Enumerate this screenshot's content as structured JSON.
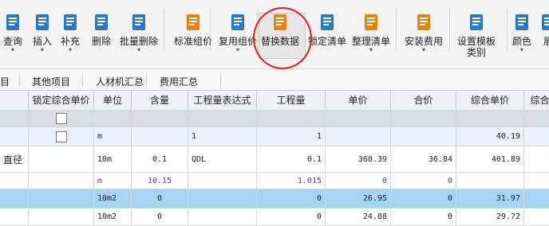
{
  "toolbar": {
    "buttons": [
      {
        "label": "查询",
        "has_arrow": true,
        "icon": "query-icon",
        "color": "#2b78c8"
      },
      {
        "label": "插入",
        "has_arrow": true,
        "icon": "insert-icon",
        "color": "#2b78c8"
      },
      {
        "label": "补充",
        "has_arrow": true,
        "icon": "supplement-icon",
        "color": "#2b78c8"
      },
      {
        "label": "删除",
        "has_arrow": false,
        "icon": "delete-icon",
        "color": "#2b78c8"
      },
      {
        "label": "批量删除",
        "has_arrow": true,
        "icon": "batch-delete-icon",
        "color": "#2b78c8"
      },
      {
        "label": "标准组价",
        "has_arrow": false,
        "icon": "standard-pricing-icon",
        "color": "#e8820e"
      },
      {
        "label": "复用组价",
        "has_arrow": true,
        "icon": "reuse-pricing-icon",
        "color": "#2b78c8"
      },
      {
        "label": "替换数据",
        "has_arrow": false,
        "icon": "replace-data-icon",
        "color": "#e8820e"
      },
      {
        "label": "锁定清单",
        "has_arrow": false,
        "icon": "lock-list-icon",
        "color": "#2b78c8"
      },
      {
        "label": "整理清单",
        "has_arrow": true,
        "icon": "organize-list-icon",
        "color": "#e8820e"
      },
      {
        "label": "安装费用",
        "has_arrow": true,
        "icon": "install-cost-icon",
        "color": "#e8820e"
      },
      {
        "label": "设置模板",
        "label2": "类别",
        "has_arrow": false,
        "icon": "template-category-icon",
        "color": "#2b78c8"
      },
      {
        "label": "颜色",
        "has_arrow": true,
        "icon": "color-icon",
        "color": "#2b78c8"
      },
      {
        "label": "展",
        "has_arrow": false,
        "icon": "expand-icon",
        "color": "#2b78c8"
      }
    ],
    "highlight_color": "#e41d1d"
  },
  "tabs": [
    "目",
    "其他项目",
    "人材机汇总",
    "费用汇总"
  ],
  "table": {
    "headers": [
      "",
      "锁定综合单价",
      "单位",
      "含量",
      "工程量表达式",
      "工程量",
      "单价",
      "合价",
      "综合单价",
      "综合"
    ],
    "rows": [
      {
        "c0": "",
        "lock": false,
        "unit": "",
        "content": "",
        "expr": "",
        "qty": "",
        "price": "",
        "total": "",
        "unitprice": "",
        "style": "group"
      },
      {
        "c0": "",
        "lock": false,
        "unit": "m",
        "content": "",
        "expr": "1",
        "qty": "1",
        "price": "",
        "total": "",
        "unitprice": "40.19",
        "style": "light"
      },
      {
        "c0": "直径",
        "lock": null,
        "unit": "10m",
        "content": "0.1",
        "expr": "QDL",
        "qty": "0.1",
        "price": "368.39",
        "total": "36.84",
        "unitprice": "401.89",
        "style": "normal"
      },
      {
        "c0": "",
        "lock": null,
        "unit": "m",
        "content": "10.15",
        "expr": "",
        "qty": "1.015",
        "price": "0",
        "total": "0",
        "unitprice": "",
        "style": "purple"
      },
      {
        "c0": "",
        "lock": null,
        "unit": "10m2",
        "content": "0",
        "expr": "",
        "qty": "0",
        "price": "26.95",
        "total": "0",
        "unitprice": "31.97",
        "style": "selected"
      },
      {
        "c0": "",
        "lock": null,
        "unit": "10m2",
        "content": "0",
        "expr": "",
        "qty": "0",
        "price": "24.88",
        "total": "0",
        "unitprice": "29.72",
        "style": "normal"
      }
    ]
  },
  "colors": {
    "selected": "#a6d4f5",
    "light": "#e9f3fd",
    "group": "#d9dde3",
    "purple": "#7a2aa8"
  }
}
